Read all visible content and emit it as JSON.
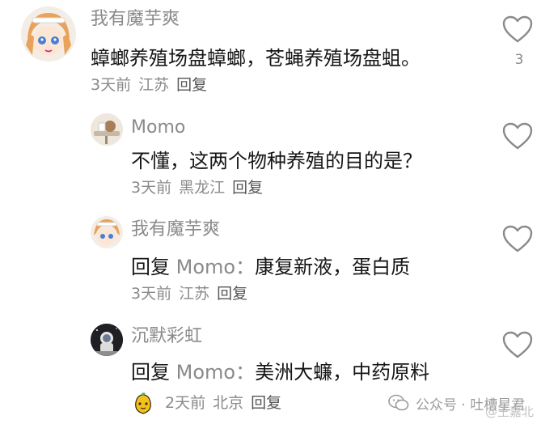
{
  "comments": [
    {
      "username": "我有魔芋爽",
      "text": "蟑螂养殖场盘蟑螂，苍蝇养殖场盘蛆。",
      "time": "3天前",
      "location": "江苏",
      "reply_label": "回复",
      "like_count": "3",
      "avatar": "anime-girl-avatar"
    },
    {
      "username": "Momo",
      "text": "不懂，这两个物种养殖的目的是？",
      "time": "3天前",
      "location": "黑龙江",
      "reply_label": "回复",
      "avatar": "cafe-table-avatar"
    },
    {
      "username": "我有魔芋爽",
      "reply_prefix": "回复",
      "reply_to": "Momo：",
      "text": "康复新液，蛋白质",
      "time": "3天前",
      "location": "江苏",
      "reply_label": "回复",
      "avatar": "anime-girl-avatar"
    },
    {
      "username": "沉默彩虹",
      "reply_prefix": "回复",
      "reply_to": "Momo：",
      "text": "美洲大蠊，中药原料",
      "time": "2天前",
      "location": "北京",
      "reply_label": "回复",
      "avatar": "astronaut-avatar"
    }
  ],
  "footer": {
    "source": "公众号 · 吐槽星君",
    "watermark": "@王嘉北"
  },
  "colors": {
    "text_primary": "#161616",
    "text_secondary": "#8a8a8a",
    "heart_stroke": "#8a8a8a"
  },
  "icons": {
    "like": "heart-outline-icon",
    "wechat": "wechat-icon",
    "reply_badge": "fruit-emoji-icon"
  }
}
